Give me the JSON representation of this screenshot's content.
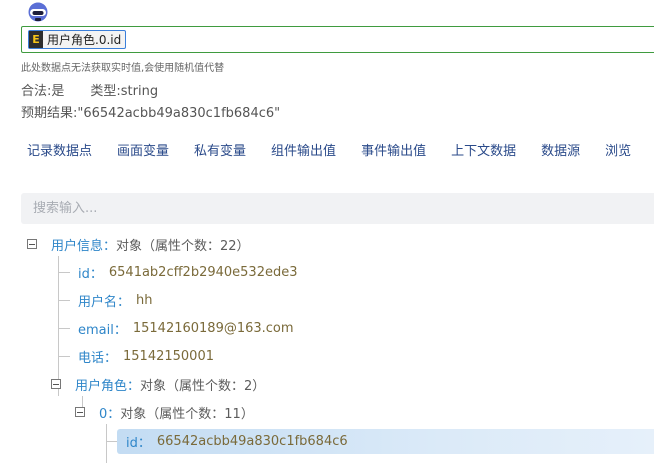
{
  "expression": {
    "token_badge": "E",
    "token_text": "用户角色.0.id"
  },
  "note": "此处数据点无法获取实时值,会使用随机值代替",
  "meta": {
    "valid": "合法:是",
    "type": "类型:string"
  },
  "expected": "预期结果:\"66542acbb49a830c1fb684c6\"",
  "tabs": [
    "记录数据点",
    "画面变量",
    "私有变量",
    "组件输出值",
    "事件输出值",
    "上下文数据",
    "数据源",
    "浏览"
  ],
  "search": {
    "placeholder": "搜索输入..."
  },
  "tree": {
    "user_info": {
      "key": "用户信息：",
      "value": "对象（属性个数：22）"
    },
    "id": {
      "key": "id：",
      "value": "6541ab2cff2b2940e532ede3"
    },
    "username": {
      "key": "用户名：",
      "value": "hh"
    },
    "email": {
      "key": "email：",
      "value": "15142160189@163.com"
    },
    "phone": {
      "key": "电话：",
      "value": "15142150001"
    },
    "user_role": {
      "key": "用户角色：",
      "value": "对象（属性个数：2）"
    },
    "role_0": {
      "key": "0：",
      "value": "对象（属性个数：11）"
    },
    "role_0_id": {
      "key": "id：",
      "value": "66542acbb49a830c1fb684c6"
    }
  },
  "colors": {
    "accent_green": "#3f9b3f",
    "tab_text": "#2a4a8a",
    "tree_key": "#2f86c9",
    "selected": "#c3dcf3"
  }
}
